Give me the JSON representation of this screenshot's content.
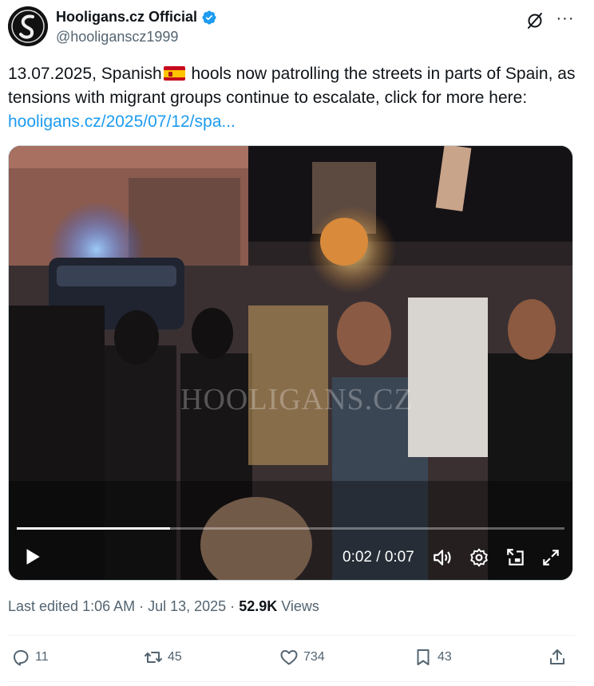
{
  "header": {
    "display_name": "Hooligans.cz Official",
    "handle": "@hooligansc z1999"
  },
  "tweet": {
    "text_before_flag": "13.07.2025, Spanish",
    "text_after_flag": " hools now patrolling the streets in parts of Spain, as tensions with migrant groups continue to escalate, click for more here: ",
    "link_text": "hooligans.cz/2025/07/12/spa..."
  },
  "video": {
    "watermark": "HOOLIGANS.CZ",
    "time": "0:02 / 0:07",
    "progress": 0.28
  },
  "meta": {
    "edited": "Last edited 1:06 AM · Jul 13, 2025 · ",
    "views_count": "52.9K",
    "views_label": " Views"
  },
  "actions": {
    "replies": "11",
    "reposts": "45",
    "likes": "734",
    "bookmarks": "43"
  },
  "colors": {
    "link": "#1d9bf0",
    "secondary_text": "#536471",
    "verified": "#1d9bf0"
  }
}
